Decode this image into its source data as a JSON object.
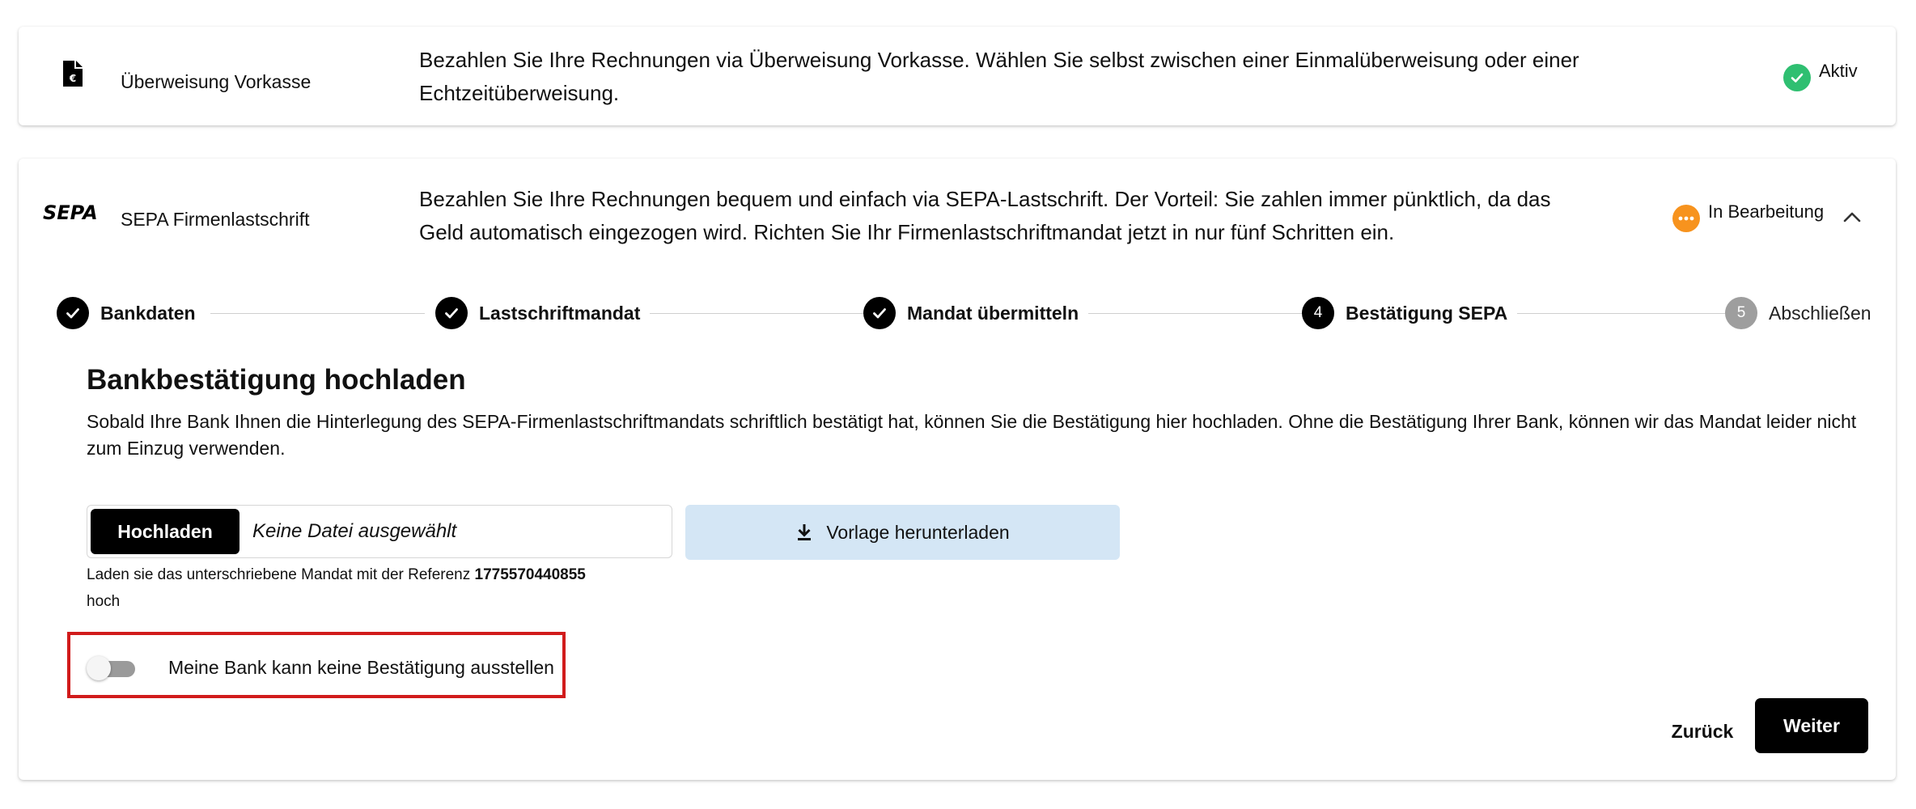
{
  "methods": [
    {
      "name": "Überweisung Vorkasse",
      "description": "Bezahlen Sie Ihre Rechnungen via Überweisung Vorkasse. Wählen Sie selbst zwischen einer Einmalüberweisung oder einer Echtzeitüberweisung.",
      "status": "Aktiv",
      "status_color": "#2fbf71",
      "icon": "document-euro-icon"
    },
    {
      "logo_text": "SEPA",
      "name": "SEPA Firmenlastschrift",
      "description": "Bezahlen Sie Ihre Rechnungen bequem und einfach via SEPA-Lastschrift. Der Vorteil: Sie zahlen immer pünktlich, da das Geld automatisch eingezogen wird. Richten Sie Ihr Firmenlastschriftmandat jetzt in nur fünf Schritten ein.",
      "status": "In Bearbeitung",
      "status_color": "#f7931e",
      "expand_icon": "chevron-up-icon"
    }
  ],
  "stepper": {
    "steps": [
      {
        "label": "Bankdaten",
        "state": "done"
      },
      {
        "label": "Lastschriftmandat",
        "state": "done"
      },
      {
        "label": "Mandat übermitteln",
        "state": "done"
      },
      {
        "number": "4",
        "label": "Bestätigung SEPA",
        "state": "active"
      },
      {
        "number": "5",
        "label": "Abschließen",
        "state": "pending"
      }
    ],
    "done_color": "#000000",
    "active_color": "#000000",
    "pending_color": "#9e9e9e"
  },
  "upload_section": {
    "title": "Bankbestätigung hochladen",
    "text": "Sobald Ihre Bank Ihnen die Hinterlegung des SEPA-Firmenlastschriftmandats schriftlich bestätigt hat, können Sie die Bestätigung hier hochladen. Ohne die Bestätigung Ihrer Bank, können wir das Mandat leider nicht zum Einzug verwenden.",
    "upload_button": "Hochladen",
    "file_placeholder": "Keine Datei ausgewählt",
    "download_button": "Vorlage herunterladen",
    "download_icon": "download-icon",
    "hint_before": "Laden sie das unterschriebene Mandat mit der Referenz ",
    "hint_reference": "1775570440855",
    "hint_after": " hoch"
  },
  "toggle": {
    "label": "Meine Bank kann keine Bestätigung ausstellen",
    "checked": false
  },
  "actions": {
    "back": "Zurück",
    "next": "Weiter"
  }
}
